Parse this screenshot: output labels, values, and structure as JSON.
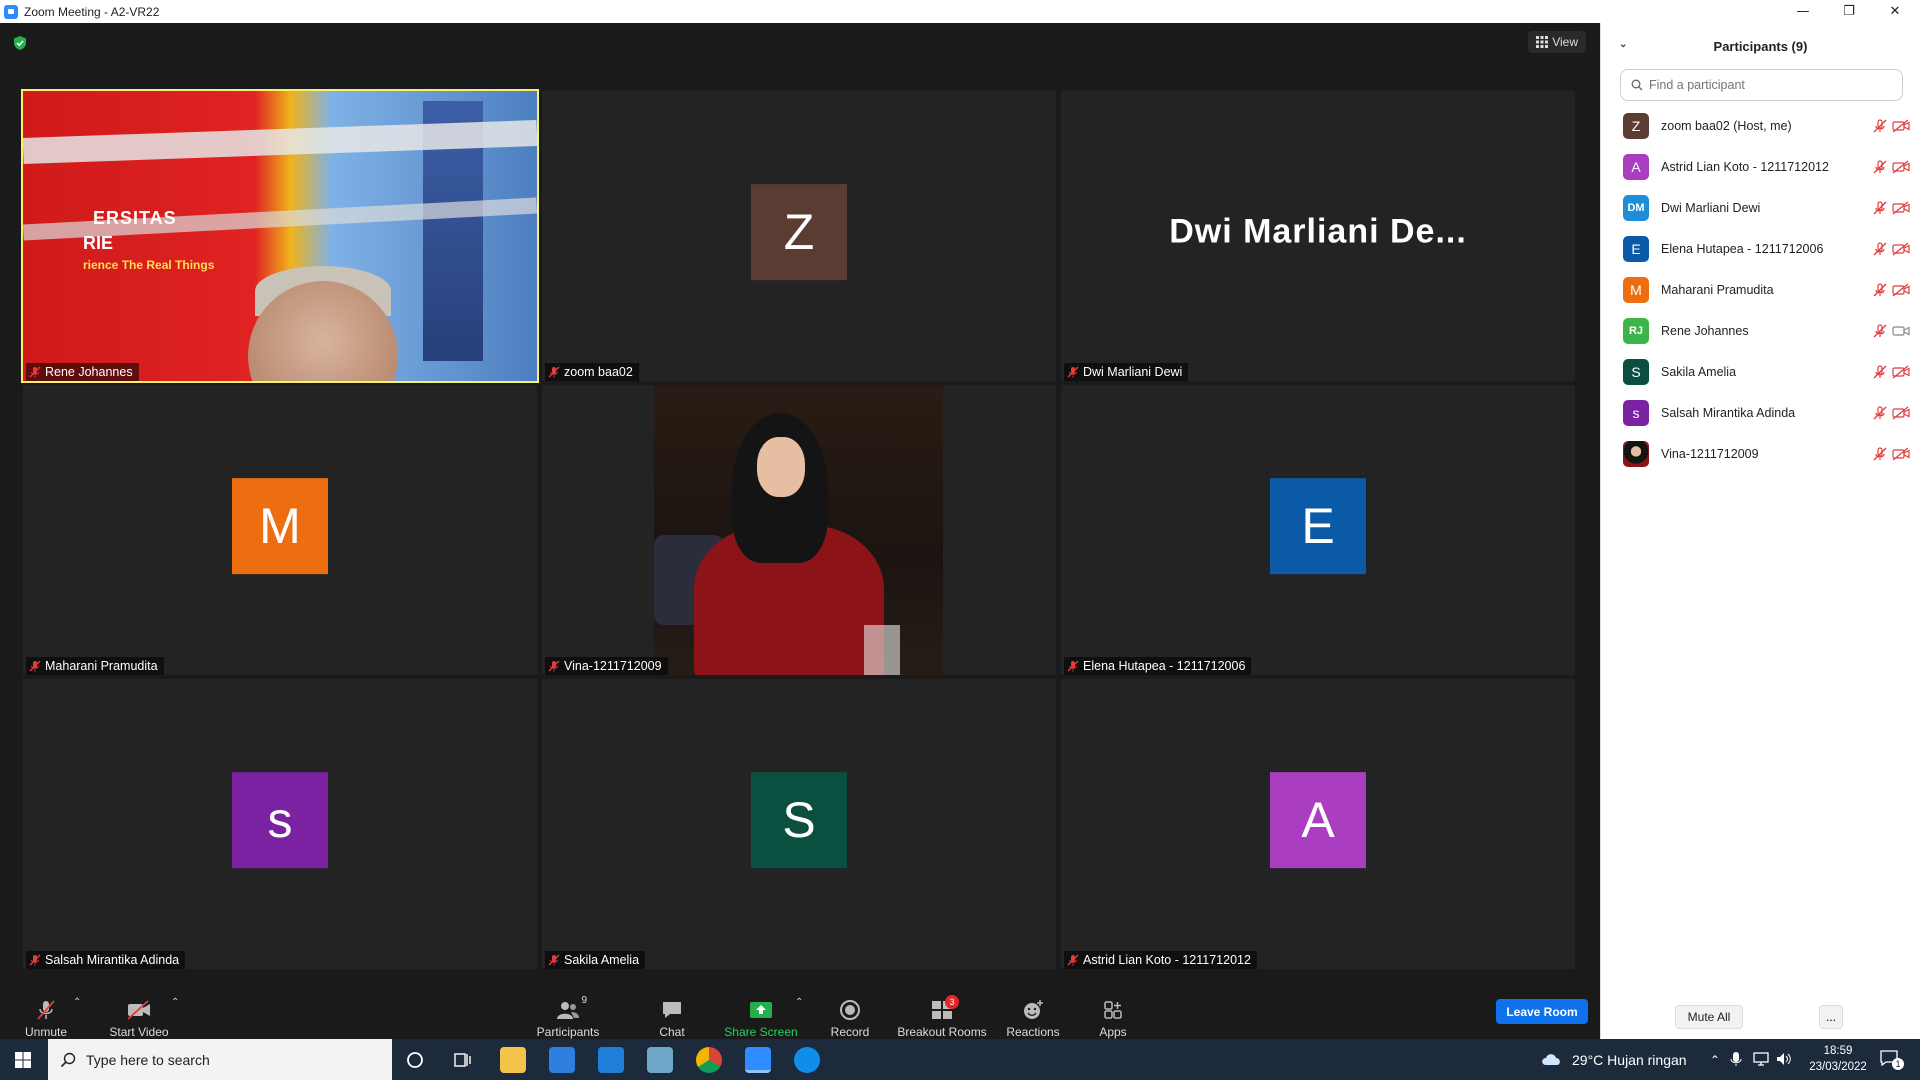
{
  "window": {
    "title": "Zoom Meeting - A2-VR22",
    "minimize": "—",
    "maximize": "❐",
    "close": "✕"
  },
  "meeting": {
    "view_label": "View"
  },
  "tiles": [
    {
      "name": "Rene Johannes",
      "kind": "video-rene",
      "active": true
    },
    {
      "name": "zoom baa02",
      "kind": "avatar",
      "initial": "Z",
      "color": "#5a3c33"
    },
    {
      "name": "Dwi Marliani Dewi",
      "kind": "bigname",
      "display": "Dwi  Marliani  De..."
    },
    {
      "name": "Maharani Pramudita",
      "kind": "avatar",
      "initial": "M",
      "color": "#ec6e10"
    },
    {
      "name": "Vina-1211712009",
      "kind": "video-vina"
    },
    {
      "name": "Elena Hutapea - 1211712006",
      "kind": "avatar",
      "initial": "E",
      "color": "#0b5aa8"
    },
    {
      "name": "Salsah Mirantika Adinda",
      "kind": "avatar",
      "initial": "s",
      "color": "#7b22a3"
    },
    {
      "name": "Sakila Amelia",
      "kind": "avatar",
      "initial": "S",
      "color": "#0a4f3f"
    },
    {
      "name": "Astrid Lian Koto - 1211712012",
      "kind": "avatar",
      "initial": "A",
      "color": "#ab3ec0"
    }
  ],
  "rene_video_text": {
    "line1": "ERSITAS",
    "line2": "RIE",
    "line3": "rience The Real Things"
  },
  "toolbar": {
    "unmute": "Unmute",
    "start_video": "Start Video",
    "participants": "Participants",
    "participants_count": "9",
    "chat": "Chat",
    "share_screen": "Share Screen",
    "record": "Record",
    "breakout_rooms": "Breakout Rooms",
    "breakout_badge": "3",
    "reactions": "Reactions",
    "apps": "Apps",
    "leave": "Leave Room"
  },
  "panel": {
    "title": "Participants (9)",
    "search_placeholder": "Find a participant",
    "participants": [
      {
        "name": "zoom baa02 (Host, me)",
        "initial": "Z",
        "color": "#5a3c33",
        "video": "off"
      },
      {
        "name": "Astrid Lian Koto - 1211712012",
        "initial": "A",
        "color": "#ab3ec0",
        "video": "off"
      },
      {
        "name": "Dwi Marliani Dewi",
        "initial": "DM",
        "color": "#1f8ed9",
        "video": "off"
      },
      {
        "name": "Elena Hutapea - 1211712006",
        "initial": "E",
        "color": "#0b5aa8",
        "video": "off"
      },
      {
        "name": "Maharani Pramudita",
        "initial": "M",
        "color": "#ec6e10",
        "video": "off"
      },
      {
        "name": "Rene Johannes",
        "initial": "RJ",
        "color": "#3bb54a",
        "video": "on"
      },
      {
        "name": "Sakila Amelia",
        "initial": "S",
        "color": "#0a4f3f",
        "video": "off"
      },
      {
        "name": "Salsah Mirantika Adinda",
        "initial": "s",
        "color": "#7b22a3",
        "video": "off"
      },
      {
        "name": "Vina-1211712009",
        "initial": "",
        "color": "#3a1f1f",
        "video": "off"
      }
    ],
    "mute_all": "Mute All",
    "more": "..."
  },
  "taskbar": {
    "search_placeholder": "Type here to search",
    "weather": "29°C  Hujan ringan",
    "time": "18:59",
    "date": "23/03/2022",
    "notification_count": "1"
  }
}
